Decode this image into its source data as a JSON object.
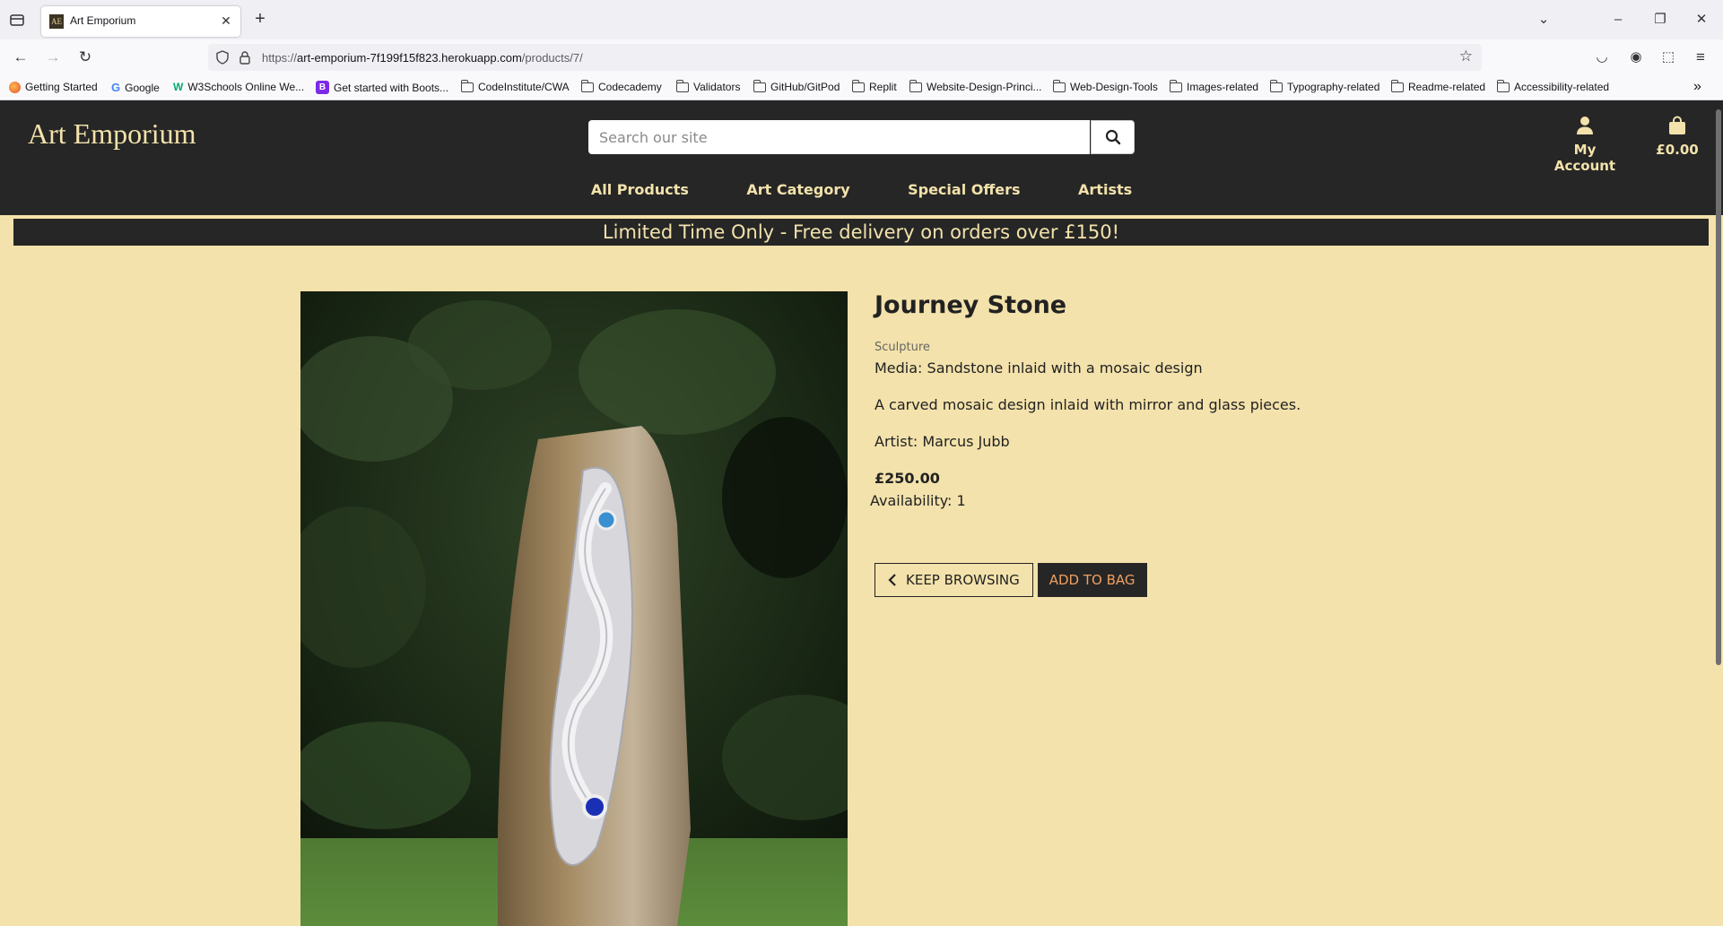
{
  "browser": {
    "tab_title": "Art Emporium",
    "tab_favicon_text": "AE",
    "url_prefix": "https://",
    "url_host": "art-emporium-7f199f15f823.herokuapp.com",
    "url_path": "/products/7/",
    "bookmarks": [
      {
        "label": "Getting Started",
        "icon": "firefox-icon"
      },
      {
        "label": "Google",
        "icon": "google-icon"
      },
      {
        "label": "W3Schools Online We...",
        "icon": "w3schools-icon"
      },
      {
        "label": "Get started with Boots...",
        "icon": "bootstrap-icon"
      },
      {
        "label": "CodeInstitute/CWA",
        "icon": "folder-icon"
      },
      {
        "label": "Codecademy",
        "icon": "folder-icon"
      },
      {
        "label": "Validators",
        "icon": "folder-icon"
      },
      {
        "label": "GitHub/GitPod",
        "icon": "folder-icon"
      },
      {
        "label": "Replit",
        "icon": "folder-icon"
      },
      {
        "label": "Website-Design-Princi...",
        "icon": "folder-icon"
      },
      {
        "label": "Web-Design-Tools",
        "icon": "folder-icon"
      },
      {
        "label": "Images-related",
        "icon": "folder-icon"
      },
      {
        "label": "Typography-related",
        "icon": "folder-icon"
      },
      {
        "label": "Readme-related",
        "icon": "folder-icon"
      },
      {
        "label": "Accessibility-related",
        "icon": "folder-icon"
      }
    ]
  },
  "site": {
    "brand": "Art Emporium",
    "search_placeholder": "Search our site",
    "account_label": "My Account",
    "bag_total": "£0.00",
    "nav": [
      "All Products",
      "Art Category",
      "Special Offers",
      "Artists"
    ],
    "promo": "Limited Time Only - Free delivery on orders over £150!",
    "colors": {
      "header": "#262626",
      "accent": "#f3e2ab",
      "page": "#f3e2ab",
      "add_to_bag_text": "#f0a060"
    }
  },
  "product": {
    "title": "Journey Stone",
    "category": "Sculpture",
    "media": "Media: Sandstone inlaid with a mosaic design",
    "description": "A carved mosaic design inlaid with mirror and glass pieces.",
    "artist": "Artist: Marcus Jubb",
    "price": "£250.00",
    "availability": "Availability: 1",
    "keep_browsing_label": "KEEP BROWSING",
    "add_to_bag_label": "ADD TO BAG"
  }
}
